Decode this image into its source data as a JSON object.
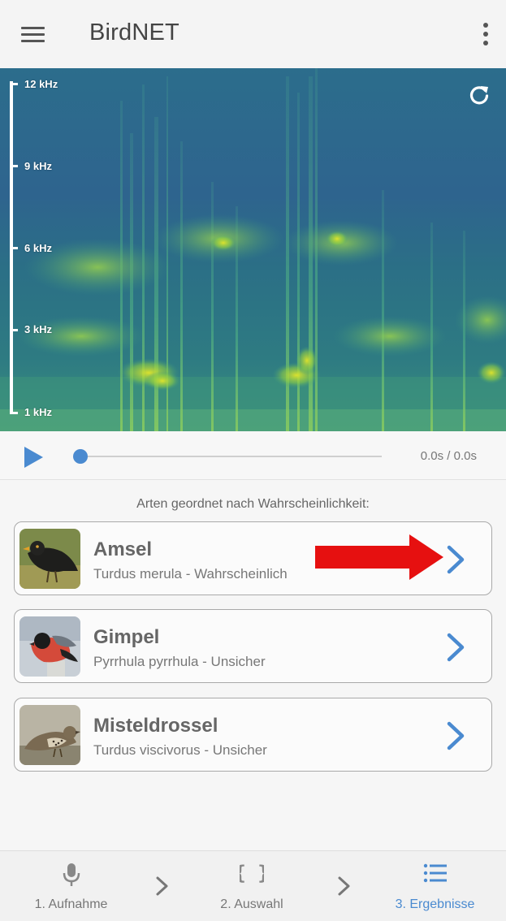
{
  "app": {
    "title": "BirdNET"
  },
  "spectrogram": {
    "freq_labels": [
      "12 kHz",
      "9 kHz",
      "6 kHz",
      "3 kHz",
      "1 kHz"
    ]
  },
  "player": {
    "time": "0.0s / 0.0s",
    "progress": 0
  },
  "results": {
    "heading": "Arten geordnet nach Wahrscheinlichkeit:",
    "items": [
      {
        "name": "Amsel",
        "subtitle": "Turdus merula - Wahrscheinlich"
      },
      {
        "name": "Gimpel",
        "subtitle": "Pyrrhula pyrrhula - Unsicher"
      },
      {
        "name": "Misteldrossel",
        "subtitle": "Turdus viscivorus - Unsicher"
      }
    ]
  },
  "bottom_nav": {
    "items": [
      {
        "label": "1. Aufnahme",
        "icon": "microphone-icon",
        "active": false
      },
      {
        "label": "2. Auswahl",
        "icon": "braces-icon",
        "active": false
      },
      {
        "label": "3. Ergebnisse",
        "icon": "list-icon",
        "active": true
      }
    ]
  },
  "colors": {
    "accent": "#4a8ad0",
    "annotation_arrow": "#e61010",
    "spectrogram_base": "#2f6a8d",
    "spectrogram_highlight": "#c6e02a"
  }
}
